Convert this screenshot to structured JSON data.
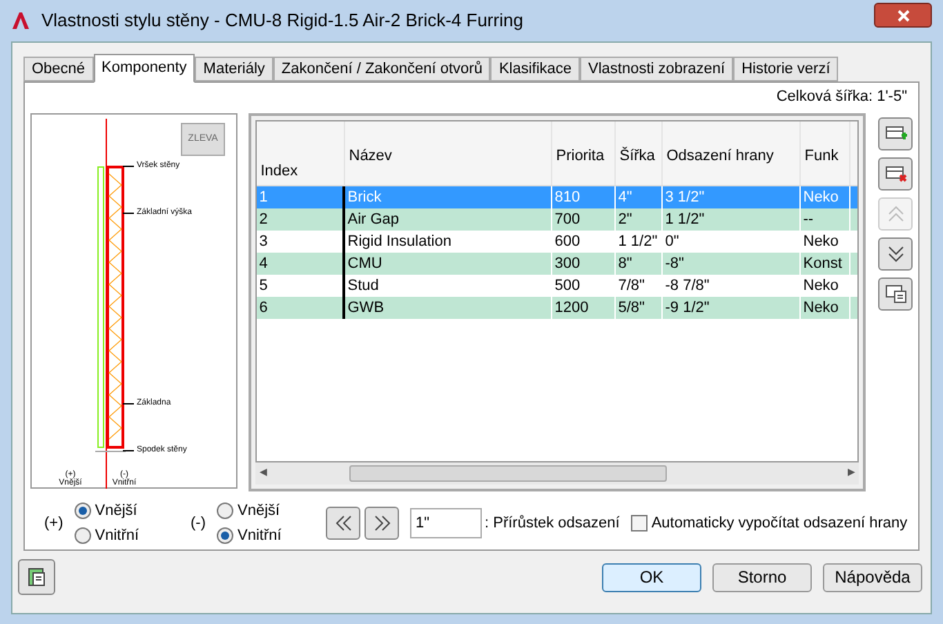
{
  "window": {
    "title": "Vlastnosti stylu stěny - CMU-8 Rigid-1.5 Air-2 Brick-4 Furring"
  },
  "tabs": [
    {
      "label": "Obecné",
      "selected": false
    },
    {
      "label": "Komponenty",
      "selected": true
    },
    {
      "label": "Materiály",
      "selected": false
    },
    {
      "label": "Zakončení / Zakončení otvorů",
      "selected": false
    },
    {
      "label": "Klasifikace",
      "selected": false
    },
    {
      "label": "Vlastnosti zobrazení",
      "selected": false
    },
    {
      "label": "Historie verzí",
      "selected": false
    }
  ],
  "total_width": "Celková šířka: 1'-5\"",
  "preview": {
    "view_button": "ZLEVA",
    "labels": [
      "Vršek stěny",
      "Základní výška",
      "Základna",
      "Spodek stěny"
    ],
    "exterior_label": "(+) Vnější",
    "interior_label": "(-) Vnitřní"
  },
  "table": {
    "columns": [
      "Index",
      "Název",
      "Priorita",
      "Šířka",
      "Odsazení hrany",
      "Funk"
    ],
    "rows": [
      {
        "cells": [
          "1",
          "Brick",
          "810",
          "4\"",
          "3 1/2\"",
          "Neko"
        ],
        "selected": true
      },
      {
        "cells": [
          "2",
          "Air Gap",
          "700",
          "2\"",
          "1 1/2\"",
          "--"
        ],
        "selected": false
      },
      {
        "cells": [
          "3",
          "Rigid Insulation",
          "600",
          "1 1/2\"",
          "0\"",
          "Neko"
        ],
        "selected": false
      },
      {
        "cells": [
          "4",
          "CMU",
          "300",
          "8\"",
          "-8\"",
          "Konst"
        ],
        "selected": false
      },
      {
        "cells": [
          "5",
          "Stud",
          "500",
          "7/8\"",
          "-8 7/8\"",
          "Neko"
        ],
        "selected": false
      },
      {
        "cells": [
          "6",
          "GWB",
          "1200",
          "5/8\"",
          "-9 1/2\"",
          "Neko"
        ],
        "selected": false
      }
    ],
    "scroll_arrows": [
      "◀",
      "▶"
    ]
  },
  "side_buttons": [
    {
      "kind": "add",
      "disabled": false
    },
    {
      "kind": "remove",
      "disabled": false
    },
    {
      "kind": "up",
      "disabled": true
    },
    {
      "kind": "down",
      "disabled": false
    },
    {
      "kind": "list",
      "disabled": false
    }
  ],
  "radio_groups": [
    {
      "sign": "(+)",
      "options": [
        {
          "label": "Vnější",
          "selected": true
        },
        {
          "label": "Vnitřní",
          "selected": false
        }
      ]
    },
    {
      "sign": "(-)",
      "options": [
        {
          "label": "Vnější",
          "selected": false
        },
        {
          "label": "Vnitřní",
          "selected": true
        }
      ]
    }
  ],
  "increment": {
    "value": "1\"",
    "label": ": Přírůstek odsazení"
  },
  "auto_calc": {
    "label": "Automaticky vypočítat odsazení hrany",
    "checked": false
  },
  "buttons": [
    {
      "label": "OK",
      "default": true
    },
    {
      "label": "Storno",
      "default": false
    },
    {
      "label": "Nápověda",
      "default": false
    }
  ]
}
